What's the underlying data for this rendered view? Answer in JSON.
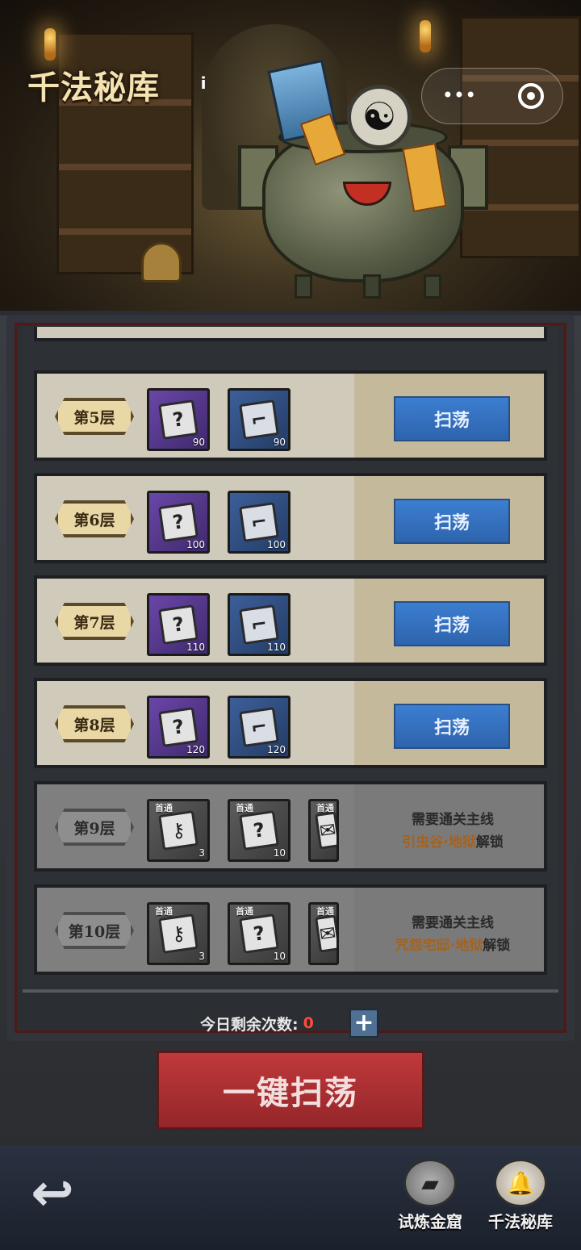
{
  "header": {
    "title": "千法秘库",
    "info_icon": "info-icon",
    "menu_icon": "more-dots-icon",
    "close_icon": "target-circle-icon"
  },
  "floors": [
    {
      "label": "第5层",
      "locked": false,
      "items": [
        {
          "icon": "bell-scroll-icon",
          "rarity": "purple",
          "count": "90"
        },
        {
          "icon": "pistol-scroll-icon",
          "rarity": "blue",
          "count": "90"
        }
      ],
      "button": "扫荡"
    },
    {
      "label": "第6层",
      "locked": false,
      "items": [
        {
          "icon": "bell-scroll-icon",
          "rarity": "purple",
          "count": "100"
        },
        {
          "icon": "pistol-scroll-icon",
          "rarity": "blue",
          "count": "100"
        }
      ],
      "button": "扫荡"
    },
    {
      "label": "第7层",
      "locked": false,
      "items": [
        {
          "icon": "bell-scroll-icon",
          "rarity": "purple",
          "count": "110"
        },
        {
          "icon": "pistol-scroll-icon",
          "rarity": "blue",
          "count": "110"
        }
      ],
      "button": "扫荡"
    },
    {
      "label": "第8层",
      "locked": false,
      "items": [
        {
          "icon": "bell-scroll-icon",
          "rarity": "purple",
          "count": "120"
        },
        {
          "icon": "pistol-scroll-icon",
          "rarity": "blue",
          "count": "120"
        }
      ],
      "button": "扫荡"
    },
    {
      "label": "第9层",
      "locked": true,
      "items": [
        {
          "icon": "key-icon",
          "tag": "首通",
          "count": "3"
        },
        {
          "icon": "mystery-scroll-icon",
          "tag": "首通",
          "count": "10"
        },
        {
          "icon": "scroll-icon",
          "tag": "首通",
          "count": ""
        }
      ],
      "lock_line1": "需要通关主线",
      "lock_place": "引虫谷·地狱",
      "lock_tail": "解锁"
    },
    {
      "label": "第10层",
      "locked": true,
      "items": [
        {
          "icon": "key-icon",
          "tag": "首通",
          "count": "3"
        },
        {
          "icon": "mystery-scroll-icon",
          "tag": "首通",
          "count": "10"
        },
        {
          "icon": "scroll-icon",
          "tag": "首通",
          "count": ""
        }
      ],
      "lock_line1": "需要通关主线",
      "lock_place": "咒怨宅邸·地狱",
      "lock_tail": "解锁"
    }
  ],
  "remaining": {
    "label": "今日剩余次数:",
    "value": "0",
    "plus_icon": "plus-icon"
  },
  "one_click_button": "一键扫荡",
  "footer": {
    "back_icon": "back-arrow-icon",
    "nav": [
      {
        "label": "试炼金窟",
        "icon": "gold-ingot-icon",
        "active": false
      },
      {
        "label": "千法秘库",
        "icon": "bell-icon",
        "active": true
      }
    ]
  },
  "colors": {
    "sweep_button": "#3c7ed0",
    "one_click": "#c0393a",
    "remaining_value": "#ff4a3a",
    "lock_highlight": "#a6621c"
  }
}
